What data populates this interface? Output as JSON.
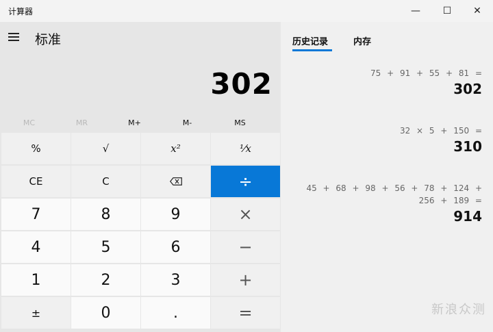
{
  "window": {
    "title": "计算器",
    "minimize": "—",
    "maximize": "☐",
    "close": "✕"
  },
  "calculator": {
    "mode": "标准",
    "display": "302"
  },
  "memory_buttons": [
    "MC",
    "MR",
    "M+",
    "M-",
    "MS"
  ],
  "keys": {
    "percent": "%",
    "sqrt": "√",
    "square": "x²",
    "reciprocal": "¹⁄x",
    "ce": "CE",
    "clear": "C",
    "backspace": "⌫",
    "divide": "÷",
    "seven": "7",
    "eight": "8",
    "nine": "9",
    "multiply": "×",
    "four": "4",
    "five": "5",
    "six": "6",
    "minus": "−",
    "one": "1",
    "two": "2",
    "three": "3",
    "plus": "+",
    "negate": "±",
    "zero": "0",
    "decimal": ".",
    "equals": "="
  },
  "tabs": {
    "history": "历史记录",
    "memory": "内存"
  },
  "history": [
    {
      "expression": "75 + 91 + 55 + 81 =",
      "result": "302"
    },
    {
      "expression": "32 × 5 + 150 =",
      "result": "310"
    },
    {
      "expression": "45 + 68 + 98 + 56 + 78 + 124 + 256 + 189 =",
      "result": "914"
    }
  ],
  "watermark": "新浪众测",
  "colors": {
    "accent": "#0878d7"
  }
}
